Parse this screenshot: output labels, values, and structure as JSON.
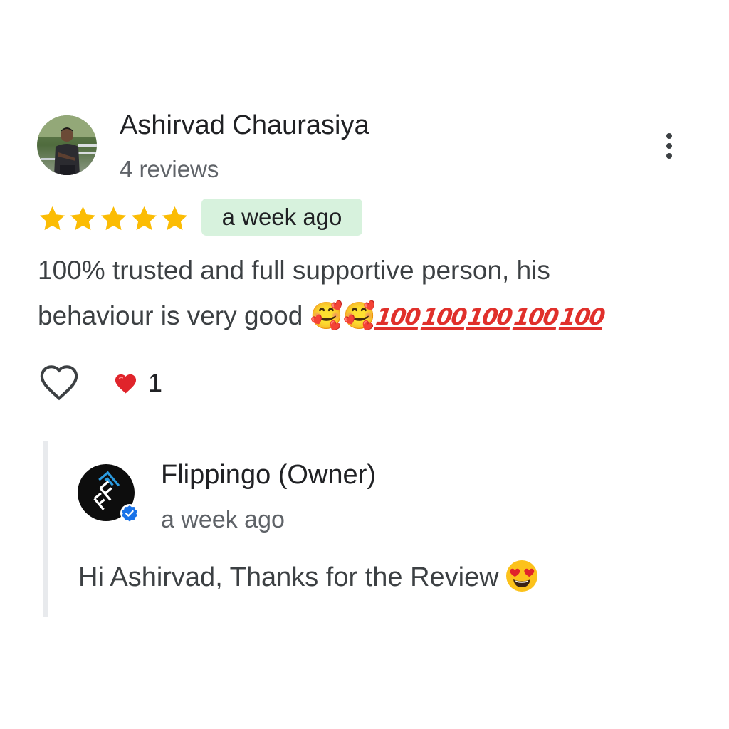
{
  "review": {
    "reviewer_name": "Ashirvad Chaurasiya",
    "review_count": "4 reviews",
    "rating": 5,
    "rating_max": 5,
    "date": "a week ago",
    "text_line1": "100% trusted and full supportive person, his",
    "text_line2": "behaviour is very good",
    "emoji_smiling_hearts": "🥰🥰",
    "hundred_points": [
      "100",
      "100",
      "100",
      "100",
      "100"
    ],
    "reaction_count": "1",
    "icons": {
      "more": "more-vert-icon",
      "like": "heart-outline-icon",
      "reaction": "red-heart-icon",
      "star": "star-icon"
    }
  },
  "owner_reply": {
    "name": "Flippingo (Owner)",
    "date": "a week ago",
    "text": "Hi Ashirvad, Thanks for the Review",
    "icons": {
      "logo": "flippingo-logo-icon",
      "verified": "verified-badge-icon",
      "emoji": "heart-eyes-emoji-icon"
    }
  },
  "colors": {
    "star": "#fbbc04",
    "date_badge_bg": "#d7f2dd",
    "verified_blue": "#1a73e8",
    "reply_bar": "#e8eaed",
    "secondary_text": "#5f6368"
  }
}
